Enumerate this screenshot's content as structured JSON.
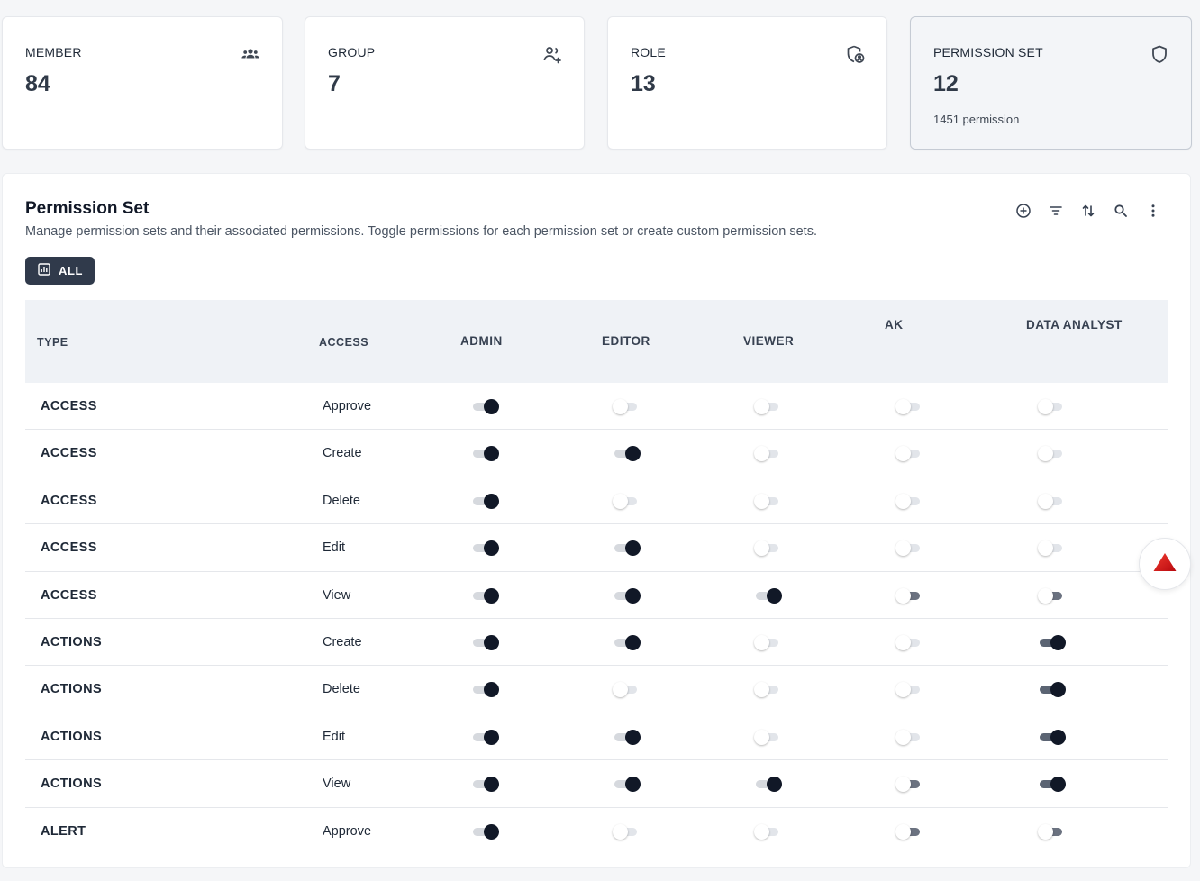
{
  "stats": [
    {
      "label": "MEMBER",
      "value": "84",
      "sub": "",
      "icon": "users-icon"
    },
    {
      "label": "GROUP",
      "value": "7",
      "sub": "",
      "icon": "user-group-icon"
    },
    {
      "label": "ROLE",
      "value": "13",
      "sub": "",
      "icon": "shield-user-icon"
    },
    {
      "label": "PERMISSION SET",
      "value": "12",
      "sub": "1451 permission",
      "icon": "shield-icon"
    }
  ],
  "panel": {
    "title": "Permission Set",
    "description": "Manage permission sets and their associated permissions. Toggle permissions for each permission set or create custom permission sets.",
    "filter_all_label": "ALL"
  },
  "toolbar": [
    "add-circle-icon",
    "filter-icon",
    "sort-icon",
    "search-icon",
    "more-vertical-icon"
  ],
  "table": {
    "headers": {
      "type": "TYPE",
      "access": "ACCESS",
      "admin": "ADMIN",
      "editor": "EDITOR",
      "viewer": "VIEWER",
      "ak": "AK",
      "data_analyst": "DATA ANALYST"
    },
    "rows": [
      {
        "type": "ACCESS",
        "access": "Approve",
        "admin": true,
        "editor": false,
        "viewer": false,
        "ak": false,
        "data_analyst": false
      },
      {
        "type": "ACCESS",
        "access": "Create",
        "admin": true,
        "editor": true,
        "viewer": false,
        "ak": false,
        "data_analyst": false
      },
      {
        "type": "ACCESS",
        "access": "Delete",
        "admin": true,
        "editor": false,
        "viewer": false,
        "ak": false,
        "data_analyst": false
      },
      {
        "type": "ACCESS",
        "access": "Edit",
        "admin": true,
        "editor": true,
        "viewer": false,
        "ak": false,
        "data_analyst": false
      },
      {
        "type": "ACCESS",
        "access": "View",
        "admin": true,
        "editor": true,
        "viewer": true,
        "ak": false,
        "data_analyst": false
      },
      {
        "type": "ACTIONS",
        "access": "Create",
        "admin": true,
        "editor": true,
        "viewer": false,
        "ak": false,
        "data_analyst": true
      },
      {
        "type": "ACTIONS",
        "access": "Delete",
        "admin": true,
        "editor": false,
        "viewer": false,
        "ak": false,
        "data_analyst": true
      },
      {
        "type": "ACTIONS",
        "access": "Edit",
        "admin": true,
        "editor": true,
        "viewer": false,
        "ak": false,
        "data_analyst": true
      },
      {
        "type": "ACTIONS",
        "access": "View",
        "admin": true,
        "editor": true,
        "viewer": true,
        "ak": false,
        "data_analyst": true
      },
      {
        "type": "ALERT",
        "access": "Approve",
        "admin": true,
        "editor": false,
        "viewer": false,
        "ak": false,
        "data_analyst": false
      }
    ]
  },
  "colors": {
    "accent": "#303a4b",
    "toggle_on": "#111827",
    "header_bg": "#eff2f6",
    "fab_icon": "#d9161b"
  },
  "fab": {
    "icon": "warning-triangle-icon"
  }
}
